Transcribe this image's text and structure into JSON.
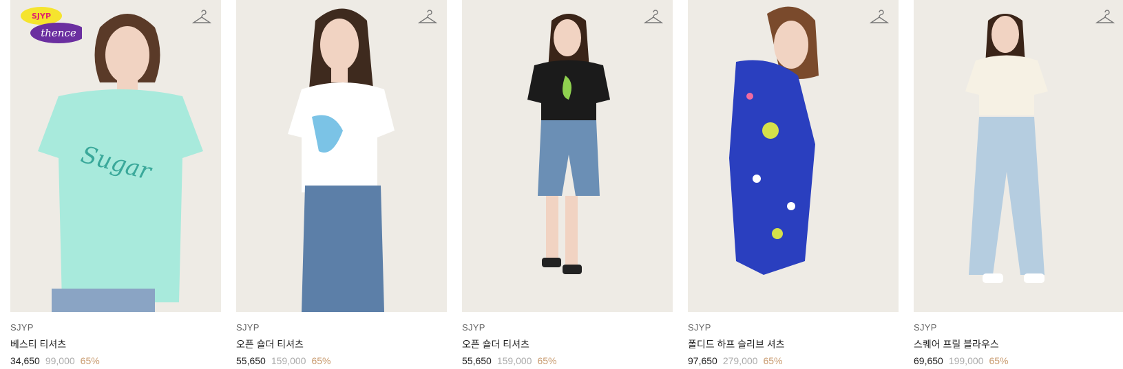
{
  "products": [
    {
      "brand": "SJYP",
      "name": "베스티 티셔츠",
      "sale_price": "34,650",
      "original_price": "99,000",
      "discount": "65%",
      "top_color": "#a8eadc",
      "bottom_color": "#8aa4c4",
      "badge": {
        "top": "SJYP",
        "bottom": "thence"
      }
    },
    {
      "brand": "SJYP",
      "name": "오픈 숄더 티셔츠",
      "sale_price": "55,650",
      "original_price": "159,000",
      "discount": "65%",
      "top_color": "#ffffff",
      "bottom_color": "#5c7fa8"
    },
    {
      "brand": "SJYP",
      "name": "오픈 숄더 티셔츠",
      "sale_price": "55,650",
      "original_price": "159,000",
      "discount": "65%",
      "top_color": "#1b1b1b",
      "bottom_color": "#6b8fb5"
    },
    {
      "brand": "SJYP",
      "name": "폴디드 하프 슬리브 셔츠",
      "sale_price": "97,650",
      "original_price": "279,000",
      "discount": "65%",
      "top_color": "#2a3fbf",
      "bottom_color": "#2a3fbf"
    },
    {
      "brand": "SJYP",
      "name": "스퀘어 프릴 블라우스",
      "sale_price": "69,650",
      "original_price": "199,000",
      "discount": "65%",
      "top_color": "#f6f1e4",
      "bottom_color": "#b5cde0"
    }
  ],
  "icons": {
    "wishlist": "hanger-icon"
  },
  "colors": {
    "photo_bg": "#eeebe5",
    "discount": "#c89a6e",
    "original_price": "#aaaaaa"
  }
}
